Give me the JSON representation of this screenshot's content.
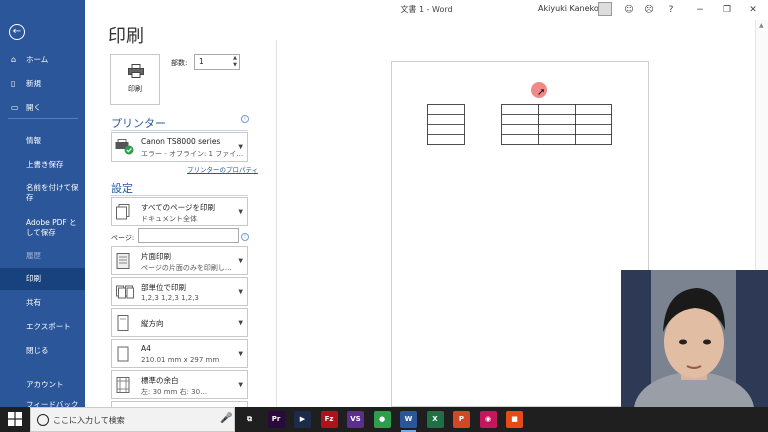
{
  "window": {
    "title": "文書 1  -  Word",
    "user_name": "Akiyuki Kaneko",
    "buttons": {
      "help": "?",
      "minimize": "−",
      "restore": "❐",
      "close": "✕"
    }
  },
  "backstage": {
    "items": [
      {
        "label": "ホーム",
        "icon": "home-icon",
        "glyph": "⌂"
      },
      {
        "label": "新規",
        "icon": "new-document-icon",
        "glyph": "▯"
      },
      {
        "label": "開く",
        "icon": "folder-open-icon",
        "glyph": "▭"
      },
      {
        "label": "情報"
      },
      {
        "label": "上書き保存"
      },
      {
        "label": "名前を付けて保存"
      },
      {
        "label": "Adobe PDF として保存"
      },
      {
        "label": "履歴"
      },
      {
        "label": "印刷"
      },
      {
        "label": "共有"
      },
      {
        "label": "エクスポート"
      },
      {
        "label": "閉じる"
      },
      {
        "label": "アカウント"
      },
      {
        "label": "フィードバック"
      }
    ]
  },
  "print": {
    "title": "印刷",
    "print_button_label": "印刷",
    "copies_label": "部数:",
    "copies_value": "1",
    "printer_heading": "プリンター",
    "printer_name": "Canon TS8000 series",
    "printer_status": "エラー - オフライン: 1 ファイ…",
    "printer_properties_link": "プリンターのプロパティ",
    "settings_heading": "設定",
    "pages_label": "ページ:",
    "settings": [
      {
        "l1": "すべてのページを印刷",
        "l2": "ドキュメント全体",
        "icon": "pages-icon"
      },
      {
        "l1": "片面印刷",
        "l2": "ページの片面のみを印刷し…",
        "icon": "one-sided-icon"
      },
      {
        "l1": "部単位で印刷",
        "l2": "1,2,3    1,2,3    1,2,3",
        "icon": "collate-icon"
      },
      {
        "l1": "縦方向",
        "l2": "",
        "icon": "portrait-icon"
      },
      {
        "l1": "A4",
        "l2": "210.01 mm x 297 mm",
        "icon": "paper-size-icon"
      },
      {
        "l1": "標準の余白",
        "l2": "左:  30 mm    右:  30…",
        "icon": "margins-icon"
      }
    ]
  },
  "taskbar": {
    "search_placeholder": "ここに入力して検索",
    "apps": [
      {
        "name": "task-view-icon",
        "label": "⧉",
        "color": "#1f1f1f"
      },
      {
        "name": "premiere-icon",
        "label": "Pr",
        "color": "#2a0a3a"
      },
      {
        "name": "video-editor-icon",
        "label": "▶",
        "color": "#1c2b4a"
      },
      {
        "name": "filezilla-icon",
        "label": "Fz",
        "color": "#b0121b"
      },
      {
        "name": "visual-studio-icon",
        "label": "VS",
        "color": "#5c2d91"
      },
      {
        "name": "chrome-icon",
        "label": "●",
        "color": "#2e9e4d"
      },
      {
        "name": "word-icon",
        "label": "W",
        "color": "#2b579a"
      },
      {
        "name": "excel-icon",
        "label": "X",
        "color": "#1e7145"
      },
      {
        "name": "powerpoint-icon",
        "label": "P",
        "color": "#d24726"
      },
      {
        "name": "camera-app-icon",
        "label": "◉",
        "color": "#c2185b"
      },
      {
        "name": "recorder-icon",
        "label": "■",
        "color": "#e64a19"
      }
    ]
  }
}
